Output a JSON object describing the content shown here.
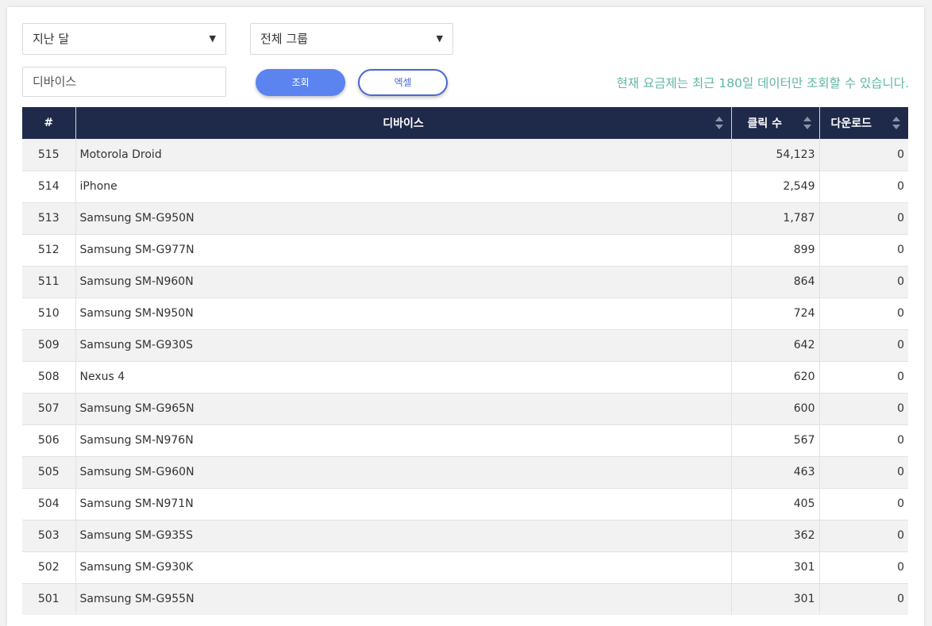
{
  "filters": {
    "period": "지난 달",
    "group": "전체 그룹",
    "device_placeholder": "디바이스"
  },
  "buttons": {
    "search": "조회",
    "excel": "엑셀"
  },
  "notice": "현재 요금제는 최근 180일 데이터만 조회할 수 있습니다.",
  "table": {
    "columns": [
      "#",
      "디바이스",
      "클릭 수",
      "다운로드"
    ],
    "rows": [
      {
        "num": "515",
        "device": "Motorola Droid",
        "clicks": "54,123",
        "downloads": "0"
      },
      {
        "num": "514",
        "device": "iPhone",
        "clicks": "2,549",
        "downloads": "0"
      },
      {
        "num": "513",
        "device": "Samsung SM-G950N",
        "clicks": "1,787",
        "downloads": "0"
      },
      {
        "num": "512",
        "device": "Samsung SM-G977N",
        "clicks": "899",
        "downloads": "0"
      },
      {
        "num": "511",
        "device": "Samsung SM-N960N",
        "clicks": "864",
        "downloads": "0"
      },
      {
        "num": "510",
        "device": "Samsung SM-N950N",
        "clicks": "724",
        "downloads": "0"
      },
      {
        "num": "509",
        "device": "Samsung SM-G930S",
        "clicks": "642",
        "downloads": "0"
      },
      {
        "num": "508",
        "device": "Nexus 4",
        "clicks": "620",
        "downloads": "0"
      },
      {
        "num": "507",
        "device": "Samsung SM-G965N",
        "clicks": "600",
        "downloads": "0"
      },
      {
        "num": "506",
        "device": "Samsung SM-N976N",
        "clicks": "567",
        "downloads": "0"
      },
      {
        "num": "505",
        "device": "Samsung SM-G960N",
        "clicks": "463",
        "downloads": "0"
      },
      {
        "num": "504",
        "device": "Samsung SM-N971N",
        "clicks": "405",
        "downloads": "0"
      },
      {
        "num": "503",
        "device": "Samsung SM-G935S",
        "clicks": "362",
        "downloads": "0"
      },
      {
        "num": "502",
        "device": "Samsung SM-G930K",
        "clicks": "301",
        "downloads": "0"
      },
      {
        "num": "501",
        "device": "Samsung SM-G955N",
        "clicks": "301",
        "downloads": "0"
      }
    ]
  },
  "colors": {
    "header_bg": "#1f2a4a",
    "primary_button": "#5b84f0",
    "notice_text": "#5fb7a5"
  },
  "icons": {
    "select_arrow": "caret-down-icon",
    "sort": "sort-icon"
  }
}
